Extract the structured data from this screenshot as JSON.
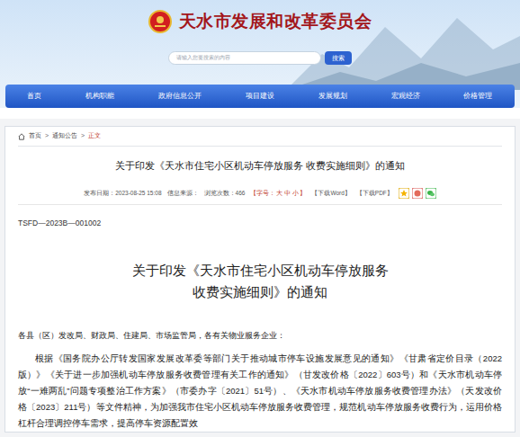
{
  "header": {
    "title": "天水市发展和改革委员会",
    "search_placeholder": "请输入您要搜索的内容",
    "search_button": "搜索"
  },
  "nav": [
    {
      "label": "首页"
    },
    {
      "label": "机构职能"
    },
    {
      "label": "政府信息公开"
    },
    {
      "label": "项目建设"
    },
    {
      "label": "发展规划"
    },
    {
      "label": "宏观经济"
    },
    {
      "label": "价格管理"
    }
  ],
  "breadcrumb": [
    {
      "label": "首页"
    },
    {
      "label": "通知公告"
    },
    {
      "label": "正文"
    }
  ],
  "breadcrumb_separator": ">",
  "article": {
    "header_title": "关于印发《天水市住宅小区机动车停放服务 收费实施细则》的通知",
    "meta": [
      "发布日期：2023-08-25 15:08",
      "信息来源：",
      "浏览次数：466"
    ],
    "font_size": {
      "prefix": "【字号：",
      "sizes": [
        "大",
        "中",
        "小"
      ],
      "suffix": "】"
    },
    "downloads": [
      "【下载Word】",
      "【下载PDF】"
    ],
    "doc_number": "TSFD—2023B—001002",
    "title_lines": [
      "关于印发《天水市住宅小区机动车停放服务",
      "收费实施细则》的通知"
    ],
    "salutation": "各县（区）发改局、财政局、住建局、市场监管局，各有关物业服务企业：",
    "paragraph": "根据《国务院办公厅转发国家发展改革委等部门关于推动城市停车设施发展意见的通知》《甘肃省定价目录（2022版）》《关于进一步加强机动车停放服务收费管理有关工作的通知》（甘发改价格〔2022〕603号）和《天水市机动车停放“一难两乱”问题专项整治工作方案》（市委办字〔2021〕51号）、《天水市机动车停放服务收费管理办法》（天发改价格〔2023〕211号）等文件精神，为加强我市住宅小区机动车停放服务收费管理，规范机动车停放服务收费行为，运用价格杠杆合理调控停车需求，提高停车资源配置效"
  }
}
